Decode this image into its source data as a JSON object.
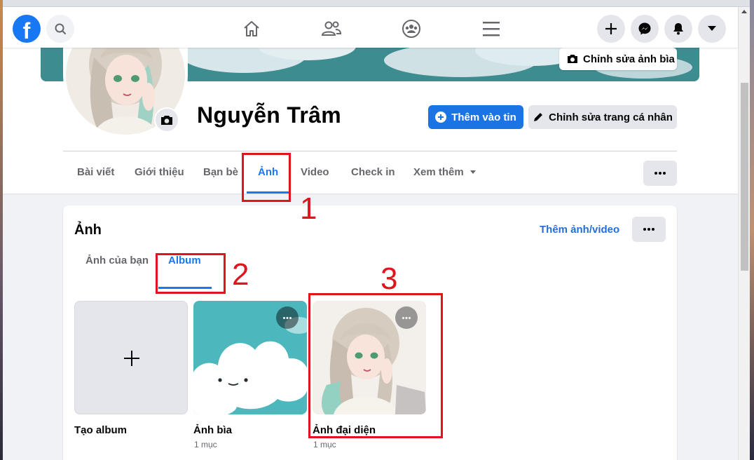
{
  "nav": {
    "logo_letter": "f"
  },
  "cover": {
    "edit_button": "Chỉnh sửa ảnh bìa"
  },
  "profile": {
    "name": "Nguyễn Trâm",
    "add_story_button": "Thêm vào tin",
    "edit_profile_button": "Chỉnh sửa trang cá nhân"
  },
  "tabs": [
    {
      "label": "Bài viết"
    },
    {
      "label": "Giới thiệu"
    },
    {
      "label": "Bạn bè"
    },
    {
      "label": "Ảnh"
    },
    {
      "label": "Video"
    },
    {
      "label": "Check in"
    },
    {
      "label": "Xem thêm"
    }
  ],
  "photos": {
    "title": "Ảnh",
    "add_link": "Thêm ảnh/video",
    "subtabs": [
      {
        "label": "Ảnh của bạn"
      },
      {
        "label": "Album"
      }
    ],
    "albums": [
      {
        "label": "Tạo album",
        "count": ""
      },
      {
        "label": "Ảnh bìa",
        "count": "1 mục"
      },
      {
        "label": "Ảnh đại diện",
        "count": "1 mục"
      }
    ]
  },
  "annotations": {
    "step1": "1",
    "step2": "2",
    "step3": "3"
  },
  "colors": {
    "brand": "#1877f2",
    "annotation": "#e0141d",
    "cover_teal": "#3d8c90"
  },
  "icons": [
    "facebook-logo-icon",
    "search-icon",
    "home-icon",
    "friends-icon",
    "groups-icon",
    "menu-icon",
    "plus-icon",
    "messenger-icon",
    "bell-icon",
    "caret-down-icon",
    "camera-icon",
    "pencil-icon",
    "more-dots-icon"
  ]
}
